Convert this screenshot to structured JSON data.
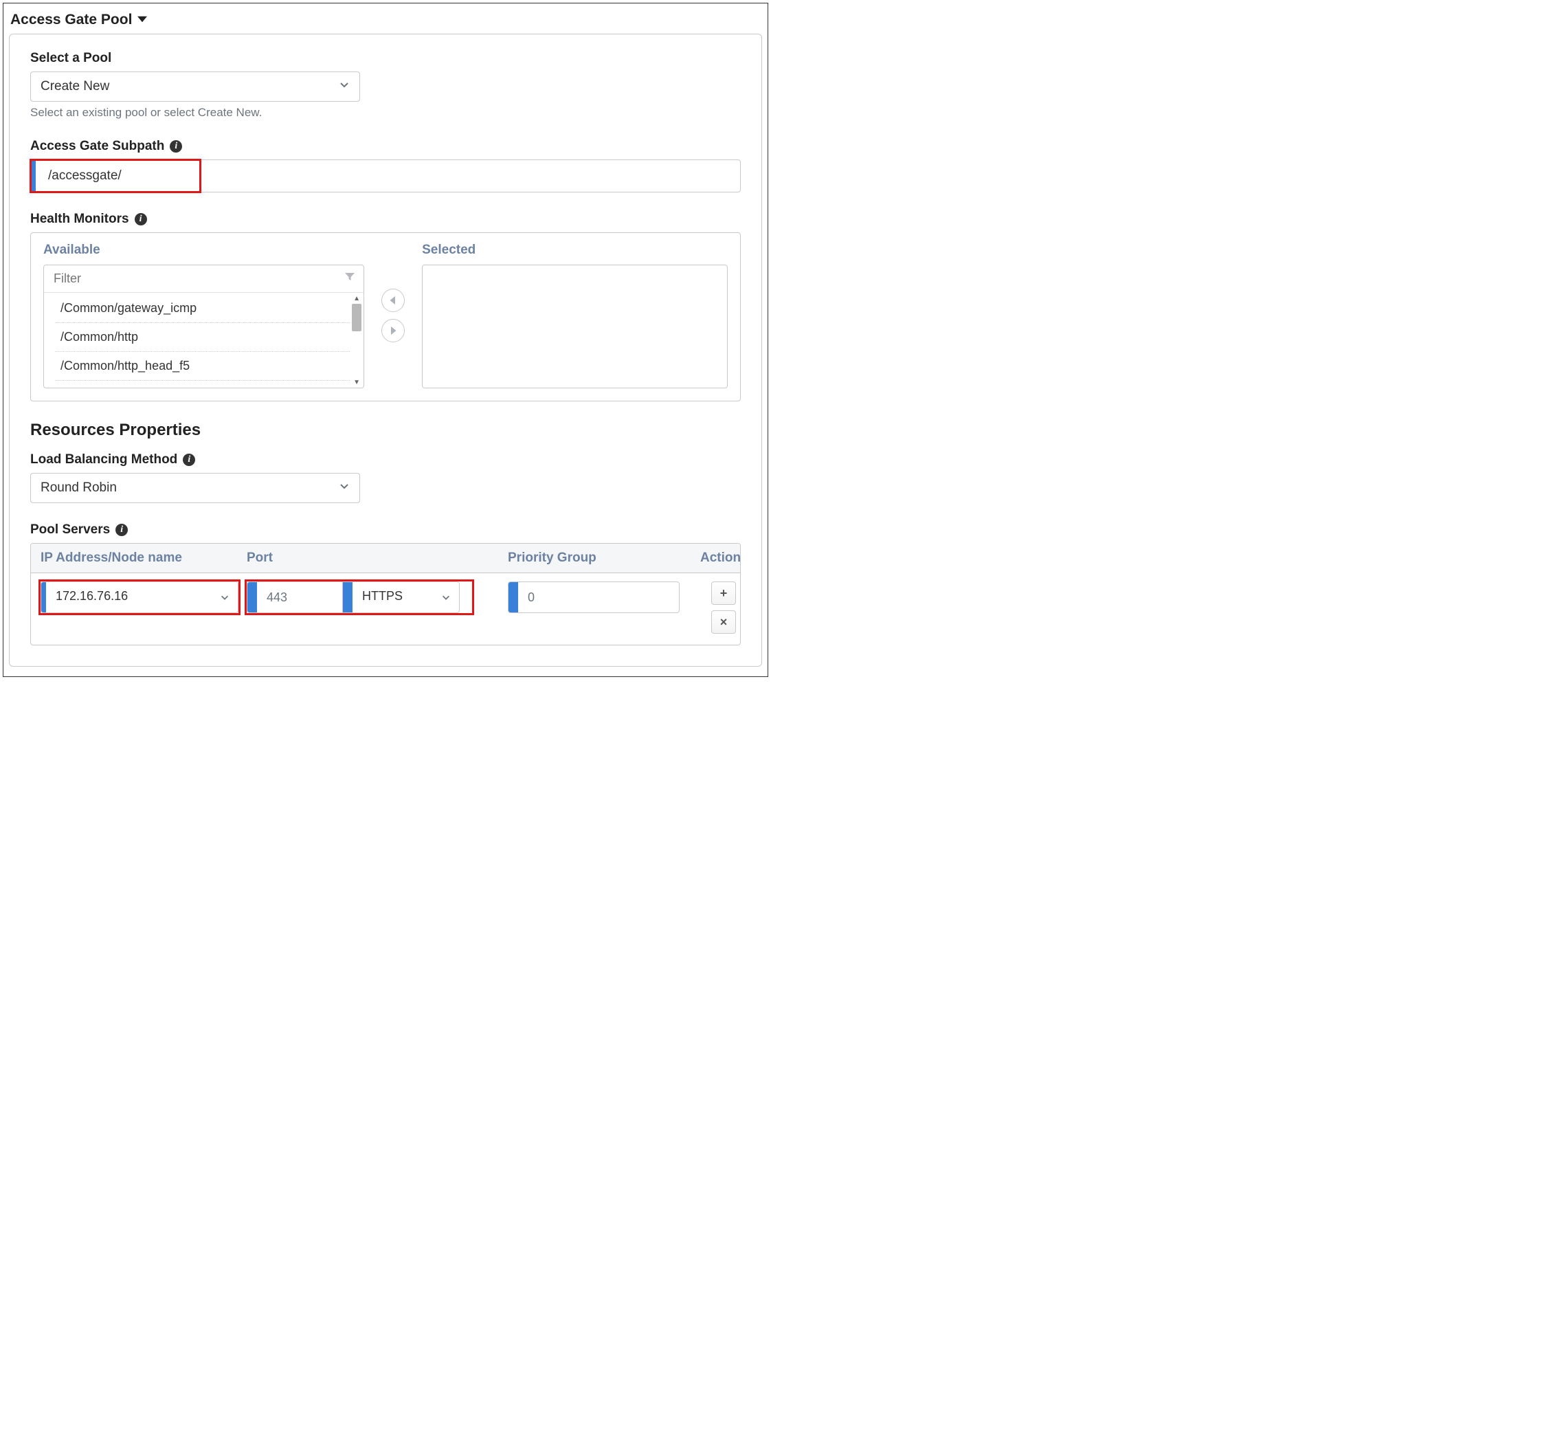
{
  "section": {
    "title": "Access Gate Pool"
  },
  "selectPool": {
    "label": "Select a Pool",
    "value": "Create New",
    "helper": "Select an existing pool or select Create New."
  },
  "subpath": {
    "label": "Access Gate Subpath",
    "value": "/accessgate/"
  },
  "healthMonitors": {
    "label": "Health Monitors",
    "available_label": "Available",
    "selected_label": "Selected",
    "filter_placeholder": "Filter",
    "available": [
      "/Common/gateway_icmp",
      "/Common/http",
      "/Common/http_head_f5"
    ]
  },
  "resources": {
    "heading": "Resources Properties",
    "lbm_label": "Load Balancing Method",
    "lbm_value": "Round Robin",
    "pool_servers_label": "Pool Servers",
    "columns": {
      "ip": "IP Address/Node name",
      "port": "Port",
      "priority": "Priority Group",
      "action": "Action"
    },
    "row": {
      "ip": "172.16.76.16",
      "port": "443",
      "protocol": "HTTPS",
      "priority": "0"
    }
  },
  "icons": {
    "info": "i",
    "plus": "+",
    "times": "×"
  }
}
